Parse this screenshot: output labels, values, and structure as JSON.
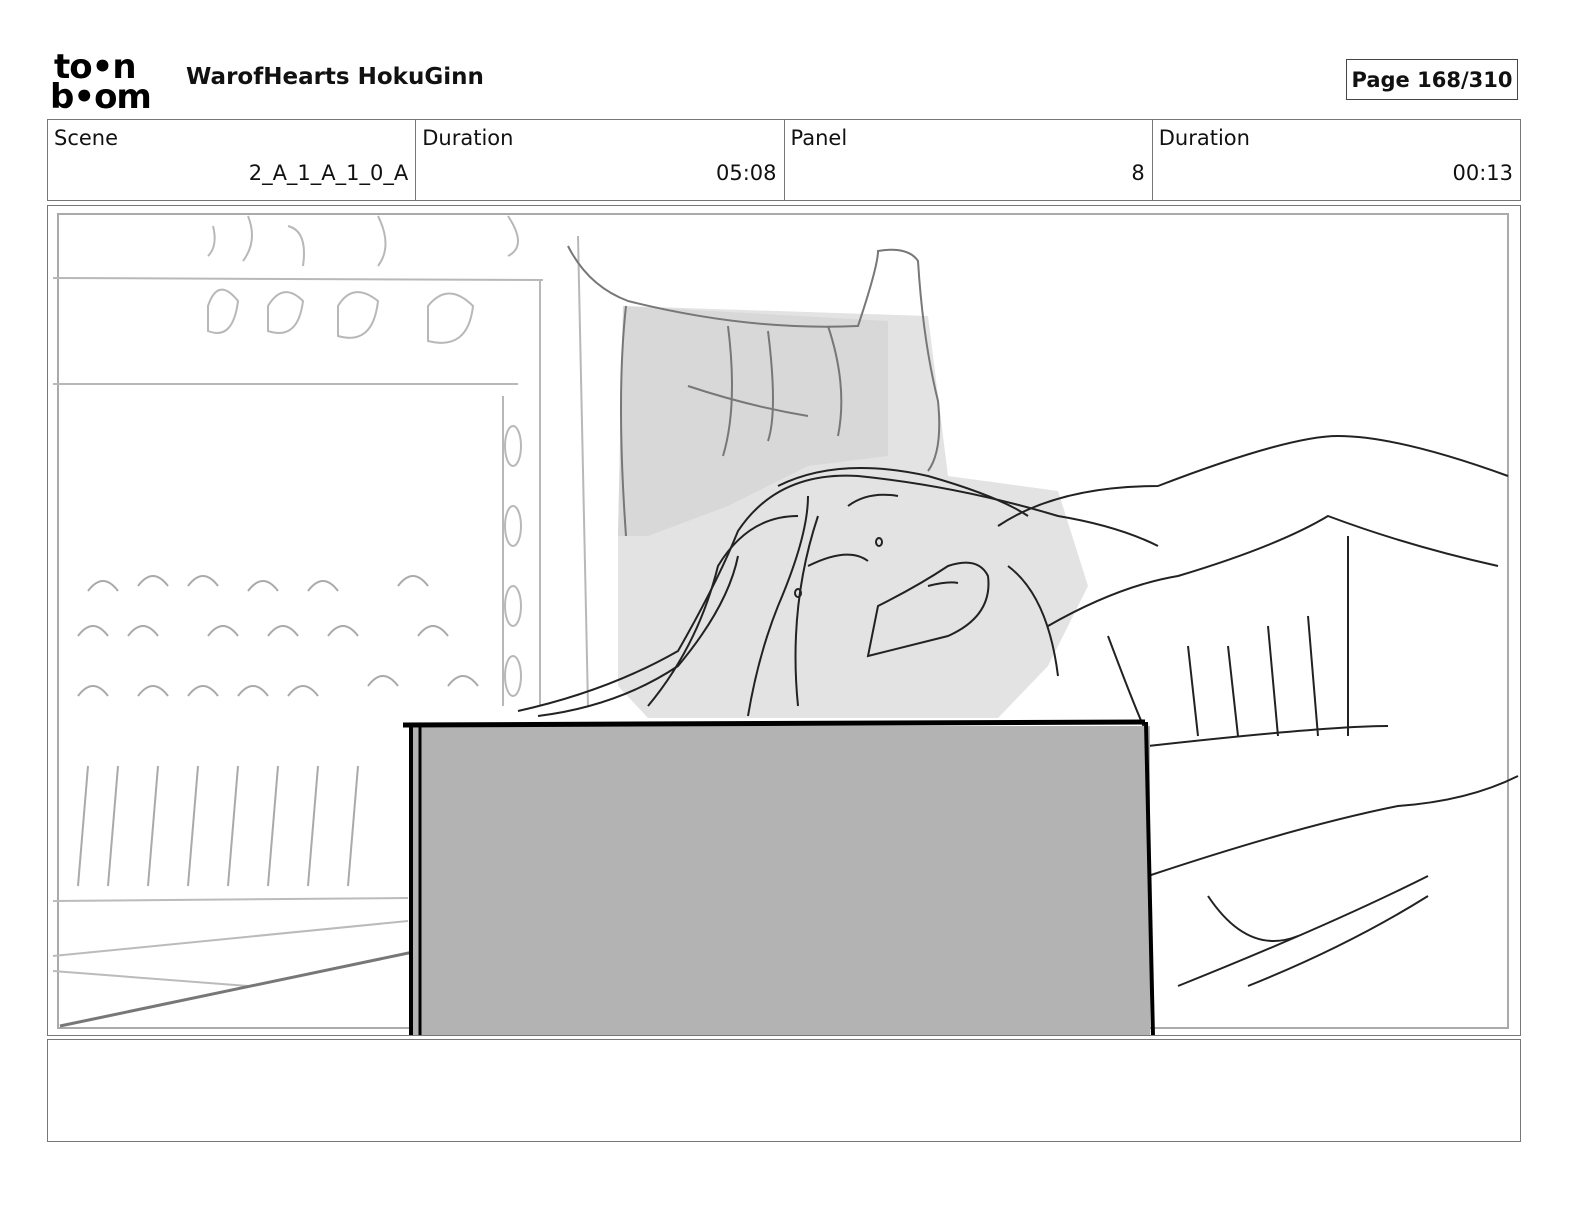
{
  "header": {
    "logo_line1": "to•n",
    "logo_line2": "b•om",
    "project_title": "WarofHearts HokuGinn",
    "page": "Page 168/310"
  },
  "info": {
    "scene_label": "Scene",
    "scene_value": "2_A_1_A_1_0_A",
    "scene_duration_label": "Duration",
    "scene_duration_value": "05:08",
    "panel_label": "Panel",
    "panel_value": "8",
    "panel_duration_label": "Duration",
    "panel_duration_value": "00:13"
  },
  "notes": {
    "text": ""
  }
}
